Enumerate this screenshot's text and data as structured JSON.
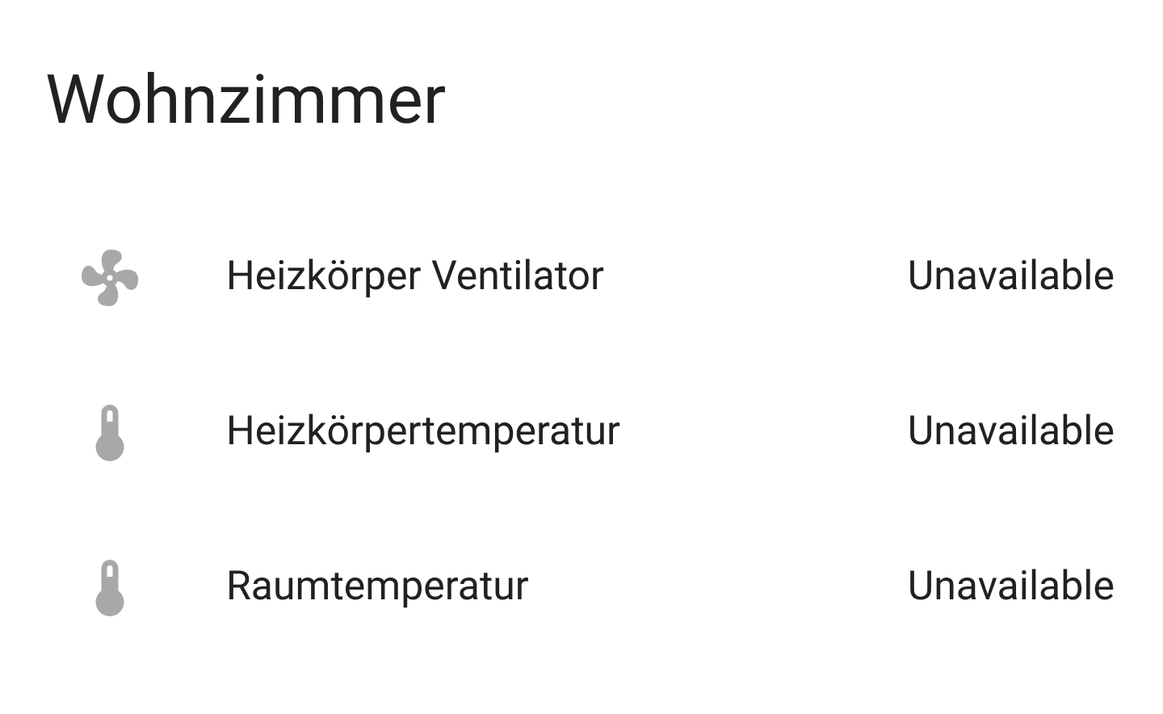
{
  "card": {
    "title": "Wohnzimmer",
    "entities": [
      {
        "kind": "fan",
        "name": "Heizkörper Ventilator",
        "state": "Unavailable"
      },
      {
        "kind": "thermometer",
        "name": "Heizkörpertemperatur",
        "state": "Unavailable"
      },
      {
        "kind": "thermometer",
        "name": "Raumtemperatur",
        "state": "Unavailable"
      }
    ]
  }
}
